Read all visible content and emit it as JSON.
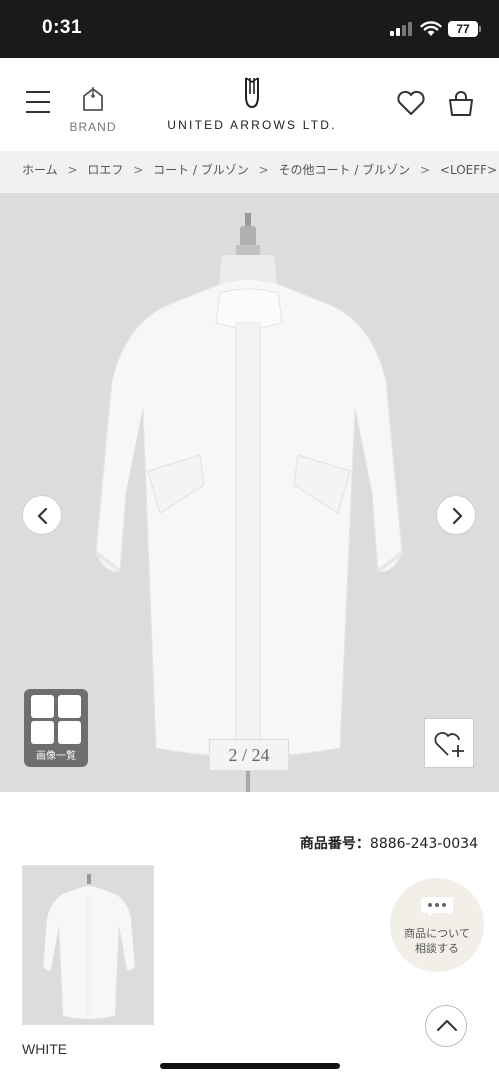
{
  "status_bar": {
    "time": "0:31",
    "battery": "77",
    "signal_icon": "cellular-signal-icon",
    "wifi_icon": "wifi-icon"
  },
  "header": {
    "menu_icon": "hamburger-menu-icon",
    "brand_label": "BRAND",
    "brand_icon": "shopping-tag-icon",
    "logo_text": "UNITED ARROWS LTD.",
    "wishlist_icon": "heart-icon",
    "cart_icon": "shopping-bag-icon"
  },
  "breadcrumb": {
    "items": [
      "ホーム",
      "ロエフ",
      "コート / ブルゾン",
      "その他コート / ブルゾン",
      "<LOEFF>"
    ],
    "separator": ">"
  },
  "gallery": {
    "counter": "2 / 24",
    "list_label": "画像一覧",
    "prev_icon": "chevron-left-icon",
    "next_icon": "chevron-right-icon",
    "favorite_icon": "heart-plus-icon",
    "background_color": "#dcdcdc"
  },
  "product": {
    "code_label": "商品番号：",
    "code": "8886-243-0034",
    "color_name": "WHITE"
  },
  "floating": {
    "chat_line1": "商品について",
    "chat_line2": "相談する",
    "chat_icon": "chat-bubble-icon",
    "chat_bg_color": "#f2efe9",
    "scroll_top_icon": "chevron-up-icon"
  }
}
